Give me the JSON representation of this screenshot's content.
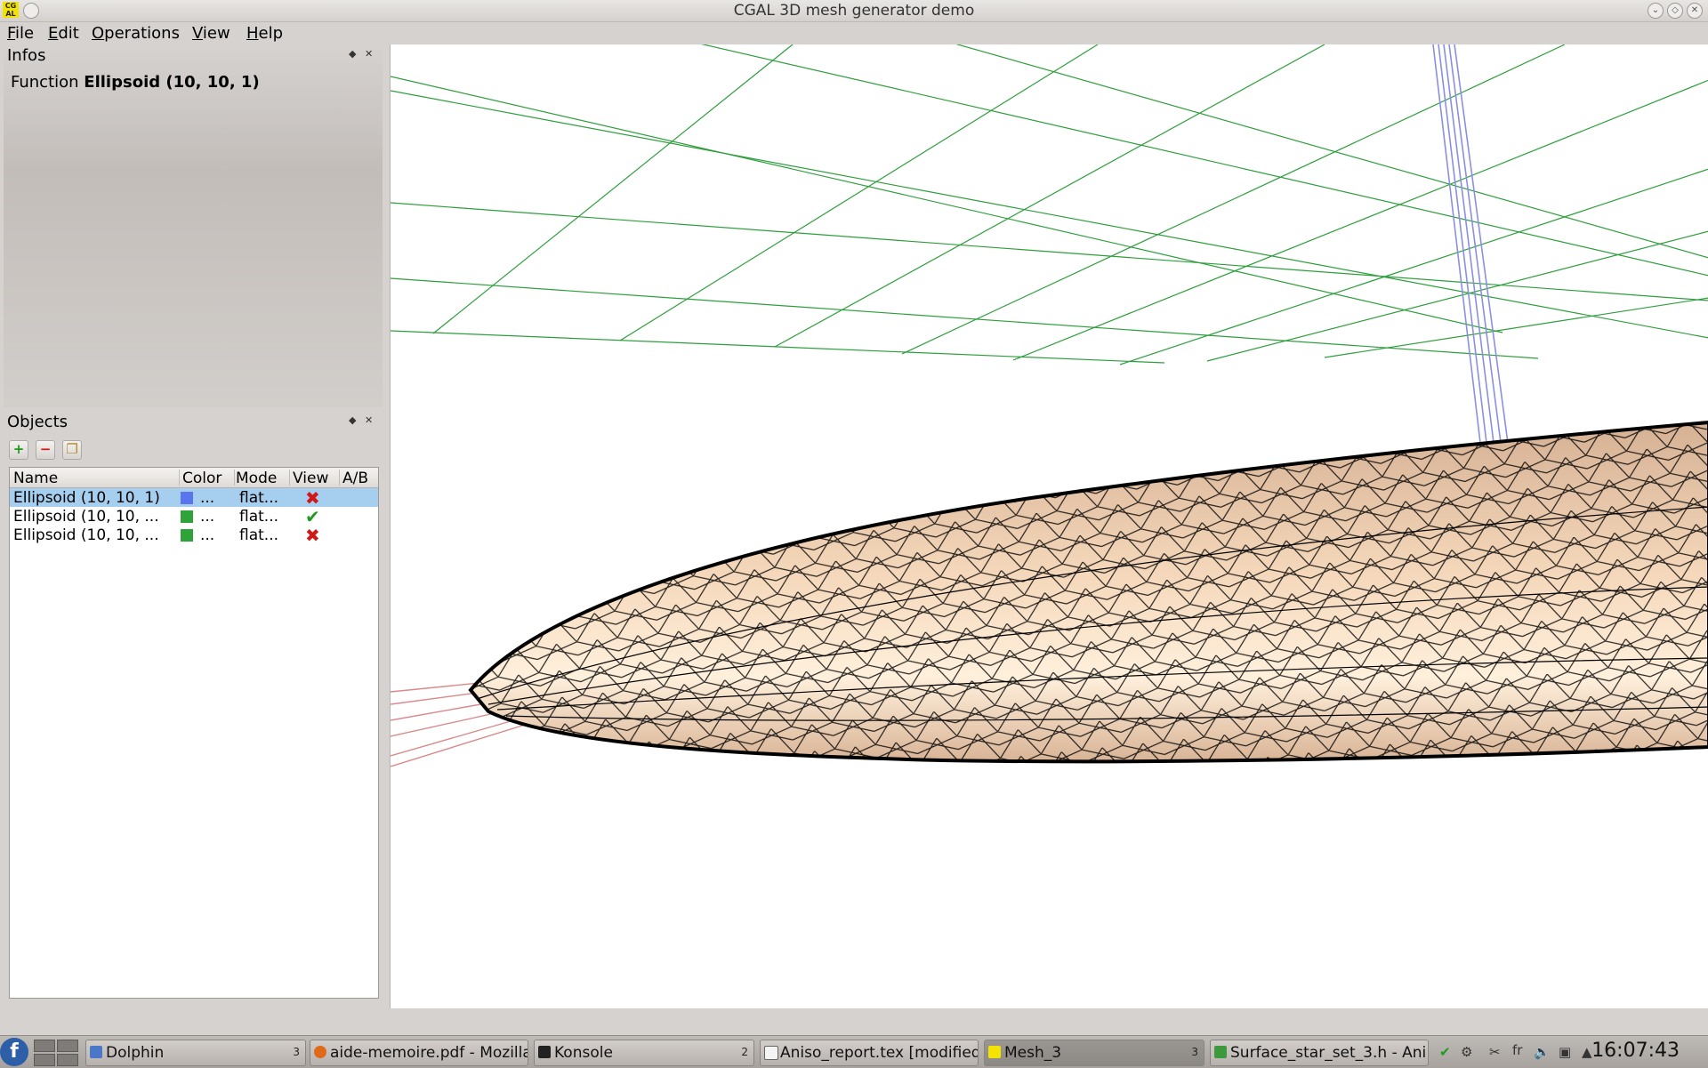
{
  "window": {
    "title": "CGAL 3D mesh generator demo",
    "icon_text": "CG AL"
  },
  "menu": [
    {
      "label": "File",
      "mnemonic": "F",
      "rest": "ile"
    },
    {
      "label": "Edit",
      "mnemonic": "E",
      "rest": "dit"
    },
    {
      "label": "Operations",
      "mnemonic": "O",
      "rest": "perations"
    },
    {
      "label": "View",
      "mnemonic": "V",
      "rest": "iew"
    },
    {
      "label": "Help",
      "mnemonic": "H",
      "rest": "elp"
    }
  ],
  "infos": {
    "title": "Infos",
    "function_prefix": "Function",
    "function_name": "Ellipsoid (10, 10, 1)"
  },
  "objects": {
    "title": "Objects",
    "columns": [
      "Name",
      "Color",
      "Mode",
      "View",
      "A/B"
    ],
    "rows": [
      {
        "name": "Ellipsoid (10, 10, 1)",
        "color": "#5a74f0",
        "color_label": "...",
        "mode": "flat...",
        "view": "hidden",
        "selected": true
      },
      {
        "name": "Ellipsoid (10, 10, ...",
        "color": "#2fa33a",
        "color_label": "...",
        "mode": "flat...",
        "view": "visible",
        "selected": false
      },
      {
        "name": "Ellipsoid (10, 10, ...",
        "color": "#2fa33a",
        "color_label": "...",
        "mode": "flat...",
        "view": "hidden",
        "selected": false
      }
    ]
  },
  "colors": {
    "grid": "#2e9e3c",
    "axis_blue": "#8a90e0",
    "axis_red": "#d88a8a",
    "mesh_fill": "#e6c3a6",
    "mesh_light": "#fbe1c6",
    "mesh_edge": "#000000",
    "selection": "#a6ceee",
    "hidden_mark": "#d01818",
    "visible_mark": "#1f9a1f"
  },
  "taskbar": {
    "tasks": [
      {
        "label": "Dolphin",
        "count": "3",
        "icon": "folder-icon"
      },
      {
        "label": "aide-memoire.pdf - Mozilla F",
        "count": "",
        "icon": "firefox-icon"
      },
      {
        "label": "Konsole",
        "count": "2",
        "icon": "terminal-icon"
      },
      {
        "label": "Aniso_report.tex [modified]",
        "count": "",
        "icon": "document-icon"
      },
      {
        "label": "Mesh_3",
        "count": "3",
        "icon": "cgal-icon"
      },
      {
        "label": "Surface_star_set_3.h - Ani",
        "count": "",
        "icon": "editor-icon"
      }
    ],
    "keyboard_layout": "fr",
    "clock": "16:07:43"
  }
}
